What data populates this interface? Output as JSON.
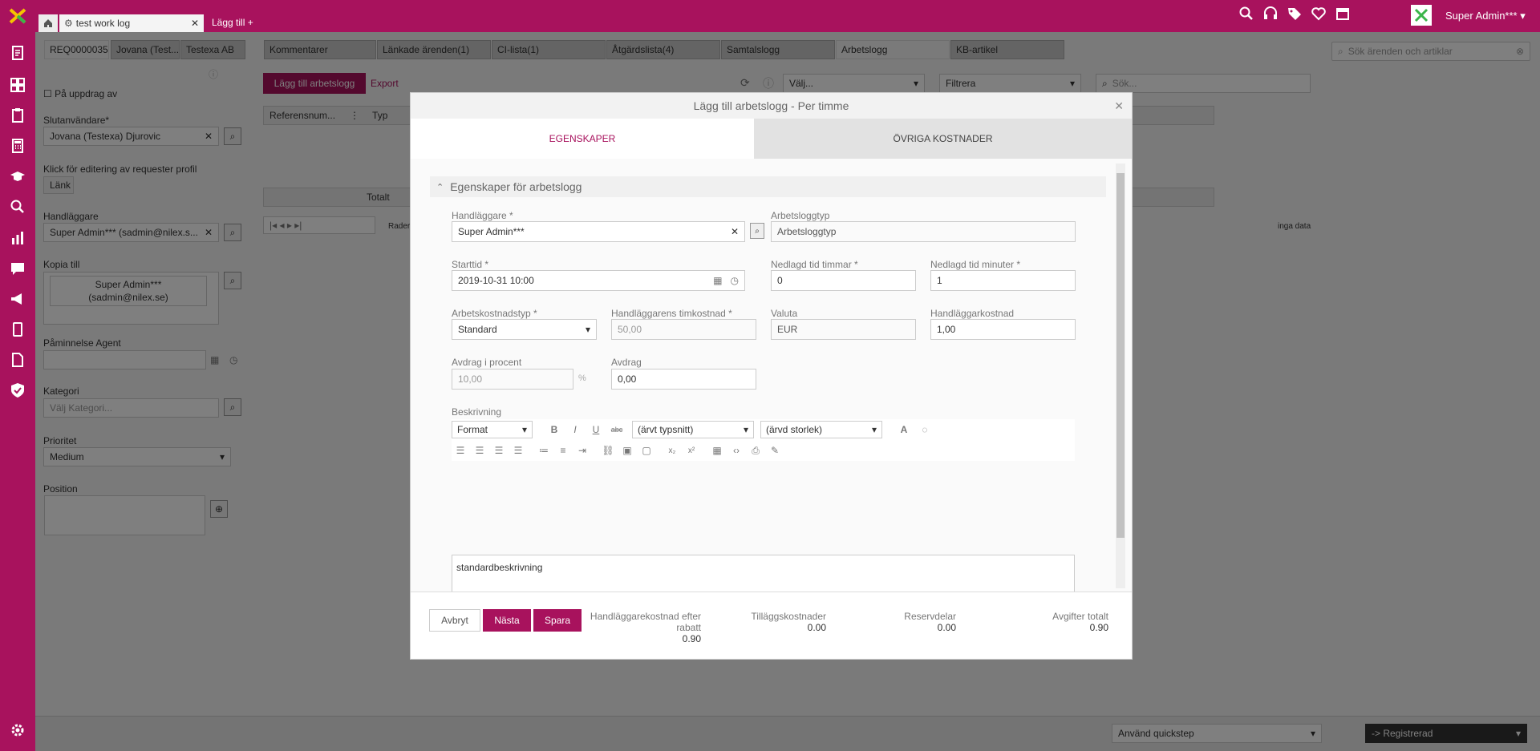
{
  "topbar": {
    "tab_title": "test work log",
    "add_tab": "Lägg till +",
    "user": "Super Admin***",
    "user_caret": "▾"
  },
  "req_tabs": [
    "REQ0000035",
    "Jovana (Test...",
    "Testexa AB"
  ],
  "detail_tabs": [
    "Kommentarer",
    "Länkade ärenden(1)",
    "CI-lista(1)",
    "Åtgärdslista(4)",
    "Samtalslogg",
    "Arbetslogg",
    "KB-artikel"
  ],
  "left_form": {
    "on_assignment": "På uppdrag av",
    "end_user_label": "Slutanvändare*",
    "end_user": "Jovana (Testexa) Djurovic",
    "edit_hint": "Klick för editering av requester profil",
    "link_button": "Länk",
    "handler_label": "Handläggare",
    "handler": "Super Admin*** (sadmin@nilex.s...",
    "copy_label": "Kopia till",
    "copy_value": "Super Admin***\n(sadmin@nilex.se)",
    "reminder_label": "Påminnelse Agent",
    "category_label": "Kategori",
    "category_placeholder": "Välj Kategori...",
    "priority_label": "Prioritet",
    "priority": "Medium",
    "position_label": "Position"
  },
  "worklog": {
    "add_button": "Lägg till arbetslogg",
    "export": "Export",
    "select": "Välj...",
    "filter": "Filtrera",
    "search_placeholder": "Sök...",
    "col_ref": "Referensnum...",
    "col_type": "Typ",
    "total": "Totalt",
    "rows_label": "Rader",
    "no_data": "inga data"
  },
  "right_search_placeholder": "Sök ärenden och artiklar",
  "modal": {
    "title": "Lägg till arbetslogg - Per timme",
    "tab_props": "EGENSKAPER",
    "tab_other": "ÖVRIGA KOSTNADER",
    "section": "Egenskaper för arbetslogg",
    "handler_label": "Handläggare *",
    "handler": "Super Admin***",
    "worklog_type_label": "Arbetsloggtyp",
    "worklog_type": "Arbetsloggtyp",
    "start_label": "Starttid *",
    "start": "2019-10-31 10:00",
    "hours_label": "Nedlagd tid timmar *",
    "hours": "0",
    "minutes_label": "Nedlagd tid minuter *",
    "minutes": "1",
    "cost_type_label": "Arbetskostnadstyp *",
    "cost_type": "Standard",
    "hourly_label": "Handläggarens timkostnad *",
    "hourly": "50,00",
    "currency_label": "Valuta",
    "currency": "EUR",
    "handler_cost_label": "Handläggarkostnad",
    "handler_cost": "1,00",
    "discount_pct_label": "Avdrag i procent",
    "discount_pct": "10,00",
    "pct_sign": "%",
    "discount_label": "Avdrag",
    "discount": "0,00",
    "desc_label": "Beskrivning",
    "format": "Format",
    "font": "(ärvt typsnitt)",
    "size": "(ärvd storlek)",
    "description": "standardbeskrivning",
    "cancel": "Avbryt",
    "next": "Nästa",
    "save": "Spara",
    "sum1_label": "Handläggarekostnad efter rabatt",
    "sum1": "0.90",
    "sum2_label": "Tilläggskostnader",
    "sum2": "0.00",
    "sum3_label": "Reservdelar",
    "sum3": "0.00",
    "sum4_label": "Avgifter totalt",
    "sum4": "0.90"
  },
  "bottom": {
    "quickstep": "Använd quickstep",
    "status": "-> Registrerad"
  },
  "colors": {
    "brand": "#a8125d"
  }
}
